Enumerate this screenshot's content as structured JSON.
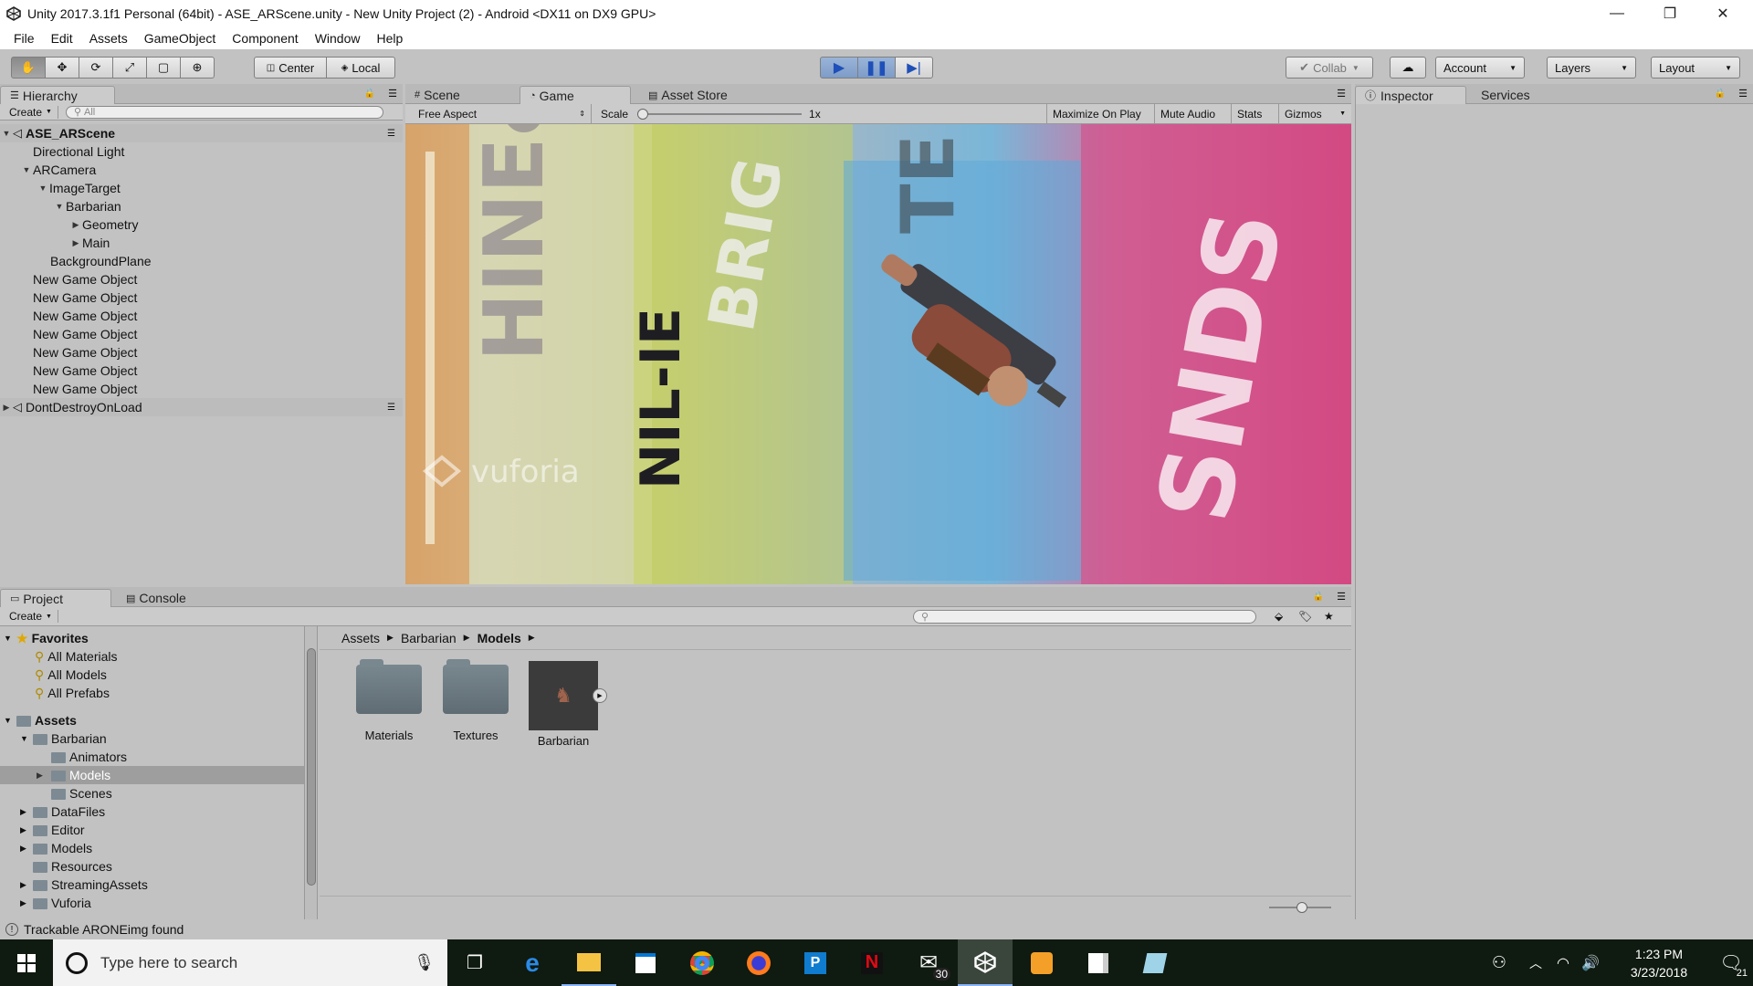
{
  "window": {
    "title": "Unity 2017.3.1f1 Personal (64bit) - ASE_ARScene.unity - New Unity Project (2) - Android <DX11 on DX9 GPU>",
    "minimize": "—",
    "restore": "❐",
    "close": "✕"
  },
  "menu": [
    "File",
    "Edit",
    "Assets",
    "GameObject",
    "Component",
    "Window",
    "Help"
  ],
  "toolbar": {
    "pivot": "Center",
    "space": "Local",
    "collab": "Collab",
    "account": "Account",
    "layers": "Layers",
    "layout": "Layout"
  },
  "hierarchy": {
    "tab": "Hierarchy",
    "create": "Create",
    "search_placeholder": "All",
    "scene": "ASE_ARScene",
    "items": [
      {
        "label": "Directional Light"
      },
      {
        "label": "ARCamera"
      },
      {
        "label": "ImageTarget"
      },
      {
        "label": "Barbarian"
      },
      {
        "label": "Geometry"
      },
      {
        "label": "Main"
      },
      {
        "label": "BackgroundPlane"
      },
      {
        "label": "New Game Object"
      },
      {
        "label": "New Game Object"
      },
      {
        "label": "New Game Object"
      },
      {
        "label": "New Game Object"
      },
      {
        "label": "New Game Object"
      },
      {
        "label": "New Game Object"
      },
      {
        "label": "New Game Object"
      }
    ],
    "dontdestroy": "DontDestroyOnLoad"
  },
  "viewtabs": {
    "scene": "Scene",
    "game": "Game",
    "store": "Asset Store"
  },
  "gamebar": {
    "aspect": "Free Aspect",
    "scale_label": "Scale",
    "scale_value": "1x",
    "maximize": "Maximize On Play",
    "mute": "Mute Audio",
    "stats": "Stats",
    "gizmos": "Gizmos"
  },
  "gameview": {
    "watermark": "vuforia"
  },
  "inspector": {
    "tab": "Inspector",
    "services": "Services"
  },
  "project": {
    "tab": "Project",
    "console": "Console",
    "create": "Create",
    "favorites": "Favorites",
    "fav_items": [
      "All Materials",
      "All Models",
      "All Prefabs"
    ],
    "assets": "Assets",
    "tree": [
      {
        "label": "Barbarian"
      },
      {
        "label": "Animators"
      },
      {
        "label": "Models"
      },
      {
        "label": "Scenes"
      },
      {
        "label": "DataFiles"
      },
      {
        "label": "Editor"
      },
      {
        "label": "Models"
      },
      {
        "label": "Resources"
      },
      {
        "label": "StreamingAssets"
      },
      {
        "label": "Vuforia"
      }
    ],
    "breadcrumb": [
      "Assets",
      "Barbarian",
      "Models"
    ],
    "grid": [
      {
        "label": "Materials"
      },
      {
        "label": "Textures"
      },
      {
        "label": "Barbarian"
      }
    ]
  },
  "status": {
    "message": "Trackable ARONEimg found"
  },
  "taskbar": {
    "search_placeholder": "Type here to search",
    "mail_badge": "30",
    "time": "1:23 PM",
    "date": "3/23/2018",
    "notif_count": "21"
  },
  "colors": {
    "play_accent": "#3d6fd6",
    "editor_bg": "#c2c2c2",
    "taskbar_bg": "#0f1a10"
  }
}
